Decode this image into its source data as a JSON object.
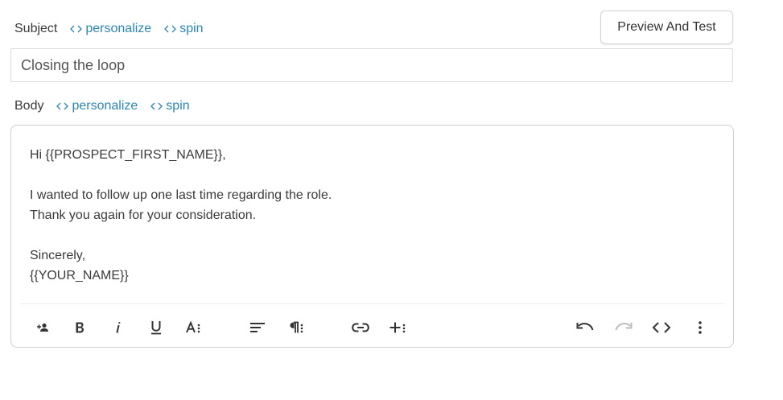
{
  "subject": {
    "label": "Subject",
    "personalize_label": "personalize",
    "spin_label": "spin",
    "value": "Closing the loop"
  },
  "preview_button_label": "Preview And Test",
  "body": {
    "label": "Body",
    "personalize_label": "personalize",
    "spin_label": "spin",
    "lines": [
      "Hi {{PROSPECT_FIRST_NAME}},",
      "",
      "I wanted to follow up one last time regarding the role.",
      "Thank you again for your consideration.",
      "",
      "Sincerely,",
      "{{YOUR_NAME}}"
    ]
  },
  "toolbar": {
    "icons": [
      "add-person-icon",
      "bold-icon",
      "italic-icon",
      "underline-icon",
      "font-size-icon",
      "align-icon",
      "paragraph-icon",
      "link-icon",
      "insert-icon",
      "undo-icon",
      "redo-icon",
      "code-view-icon",
      "more-vert-icon"
    ],
    "redo_disabled": true
  },
  "colors": {
    "link": "#2b86b6",
    "text": "#3a3a3a",
    "border": "#cfcfcf",
    "icon": "#333333",
    "icon_disabled": "#bbbbbb"
  }
}
